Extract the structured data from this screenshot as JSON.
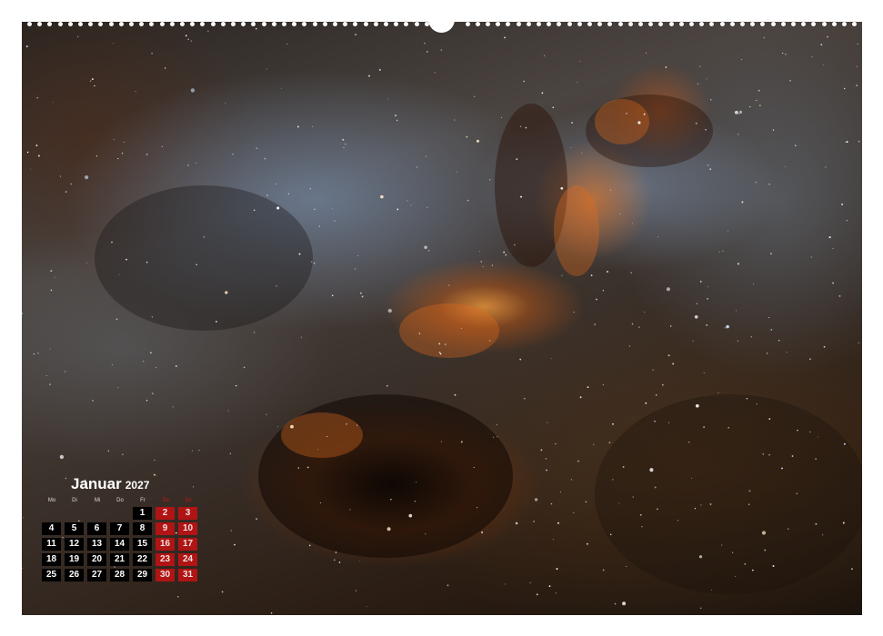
{
  "calendar": {
    "month": "Januar",
    "year": "2027",
    "weekdays": [
      "Mo",
      "Di",
      "Mi",
      "Do",
      "Fr",
      "Sa",
      "So"
    ],
    "weekend_columns": [
      5,
      6
    ],
    "weeks": [
      [
        "",
        "",
        "",
        "",
        "1",
        "2",
        "3"
      ],
      [
        "4",
        "5",
        "6",
        "7",
        "8",
        "9",
        "10"
      ],
      [
        "11",
        "12",
        "13",
        "14",
        "15",
        "16",
        "17"
      ],
      [
        "18",
        "19",
        "20",
        "21",
        "22",
        "23",
        "24"
      ],
      [
        "25",
        "26",
        "27",
        "28",
        "29",
        "30",
        "31"
      ]
    ]
  },
  "colors": {
    "weekend_cell": "#b01414",
    "weekday_cell": "#000000",
    "text": "#ffffff",
    "page_background": "#ffffff"
  },
  "photo": {
    "subject_icon": "nebula-photo"
  }
}
